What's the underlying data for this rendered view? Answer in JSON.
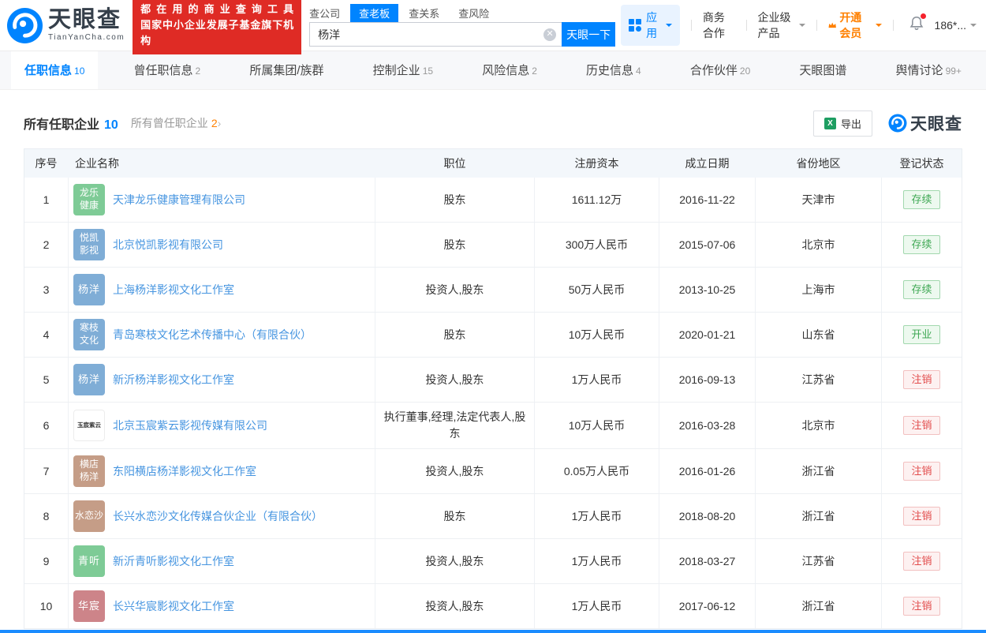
{
  "brand": {
    "name": "天眼查",
    "domain": "TianYanCha.com",
    "accent": "#0084ff"
  },
  "promo": {
    "line1": "都在用的商业查询工具",
    "line2": "国家中小企业发展子基金旗下机构",
    "bg": "#df2b25"
  },
  "search": {
    "tabs": [
      {
        "label": "查公司",
        "active": false
      },
      {
        "label": "查老板",
        "active": true
      },
      {
        "label": "查关系",
        "active": false
      },
      {
        "label": "查风险",
        "active": false
      }
    ],
    "value": "杨洋",
    "button_label": "天眼一下"
  },
  "header_menu": {
    "apps_label": "应用",
    "business_label": "商务合作",
    "enterprise_label": "企业级产品",
    "vip_label": "开通会员",
    "vip_color": "#ff8000",
    "phone_label": "186*..."
  },
  "nav_tabs": [
    {
      "label": "任职信息",
      "count": "10",
      "active": true
    },
    {
      "label": "曾任职信息",
      "count": "2",
      "active": false
    },
    {
      "label": "所属集团/族群",
      "count": "",
      "active": false
    },
    {
      "label": "控制企业",
      "count": "15",
      "active": false
    },
    {
      "label": "风险信息",
      "count": "2",
      "active": false
    },
    {
      "label": "历史信息",
      "count": "4",
      "active": false
    },
    {
      "label": "合作伙伴",
      "count": "20",
      "active": false
    },
    {
      "label": "天眼图谱",
      "count": "",
      "active": false
    },
    {
      "label": "舆情讨论",
      "count": "99+",
      "active": false
    }
  ],
  "section": {
    "title": "所有任职企业",
    "title_count": "10",
    "subtitle": "所有曾任职企业",
    "subtitle_count": "2",
    "arrow": "›",
    "export_label": "导出",
    "watermark": "天眼查"
  },
  "table": {
    "headers": [
      "序号",
      "企业名称",
      "职位",
      "注册资本",
      "成立日期",
      "省份地区",
      "登记状态"
    ],
    "link_color": "#4695e0",
    "status_colors": {
      "green": "#3fa854",
      "red": "#e24c4c"
    },
    "rows": [
      {
        "no": "1",
        "icon_lines": [
          "龙乐",
          "健康"
        ],
        "icon_bg": "#7ecb96",
        "icon_variant": "solid",
        "name": "天津龙乐健康管理有限公司",
        "position": "股东",
        "capital": "1611.12万",
        "date": "2016-11-22",
        "province": "天津市",
        "status": "存续",
        "status_type": "green"
      },
      {
        "no": "2",
        "icon_lines": [
          "悦凯",
          "影视"
        ],
        "icon_bg": "#7fadd6",
        "icon_variant": "solid",
        "name": "北京悦凯影视有限公司",
        "position": "股东",
        "capital": "300万人民币",
        "date": "2015-07-06",
        "province": "北京市",
        "status": "存续",
        "status_type": "green"
      },
      {
        "no": "3",
        "icon_lines": [
          "杨洋"
        ],
        "icon_bg": "#7fadd6",
        "icon_variant": "solid",
        "name": "上海杨洋影视文化工作室",
        "position": "投资人,股东",
        "capital": "50万人民币",
        "date": "2013-10-25",
        "province": "上海市",
        "status": "存续",
        "status_type": "green"
      },
      {
        "no": "4",
        "icon_lines": [
          "寒枝",
          "文化"
        ],
        "icon_bg": "#7fadd6",
        "icon_variant": "solid",
        "name": "青岛寒枝文化艺术传播中心（有限合伙）",
        "position": "股东",
        "capital": "10万人民币",
        "date": "2020-01-21",
        "province": "山东省",
        "status": "开业",
        "status_type": "green"
      },
      {
        "no": "5",
        "icon_lines": [
          "杨洋"
        ],
        "icon_bg": "#7fadd6",
        "icon_variant": "solid",
        "name": "新沂杨洋影视文化工作室",
        "position": "投资人,股东",
        "capital": "1万人民币",
        "date": "2016-09-13",
        "province": "江苏省",
        "status": "注销",
        "status_type": "red"
      },
      {
        "no": "6",
        "icon_lines": [
          "玉宸紫云"
        ],
        "icon_bg": "#ffffff",
        "icon_variant": "light",
        "name": "北京玉宸紫云影视传媒有限公司",
        "position": "执行董事,经理,法定代表人,股东",
        "capital": "10万人民币",
        "date": "2016-03-28",
        "province": "北京市",
        "status": "注销",
        "status_type": "red"
      },
      {
        "no": "7",
        "icon_lines": [
          "横店",
          "杨洋"
        ],
        "icon_bg": "#c59d87",
        "icon_variant": "solid",
        "name": "东阳横店杨洋影视文化工作室",
        "position": "投资人,股东",
        "capital": "0.05万人民币",
        "date": "2016-01-26",
        "province": "浙江省",
        "status": "注销",
        "status_type": "red"
      },
      {
        "no": "8",
        "icon_lines": [
          "水恋沙"
        ],
        "icon_bg": "#c59d87",
        "icon_variant": "solid",
        "name": "长兴水恋沙文化传媒合伙企业（有限合伙）",
        "position": "股东",
        "capital": "1万人民币",
        "date": "2018-08-20",
        "province": "浙江省",
        "status": "注销",
        "status_type": "red"
      },
      {
        "no": "9",
        "icon_lines": [
          "青听"
        ],
        "icon_bg": "#7ecb96",
        "icon_variant": "solid",
        "name": "新沂青听影视文化工作室",
        "position": "投资人,股东",
        "capital": "1万人民币",
        "date": "2018-03-27",
        "province": "江苏省",
        "status": "注销",
        "status_type": "red"
      },
      {
        "no": "10",
        "icon_lines": [
          "华宸"
        ],
        "icon_bg": "#cd8489",
        "icon_variant": "solid",
        "name": "长兴华宸影视文化工作室",
        "position": "投资人,股东",
        "capital": "1万人民币",
        "date": "2017-06-12",
        "province": "浙江省",
        "status": "注销",
        "status_type": "red"
      }
    ]
  }
}
